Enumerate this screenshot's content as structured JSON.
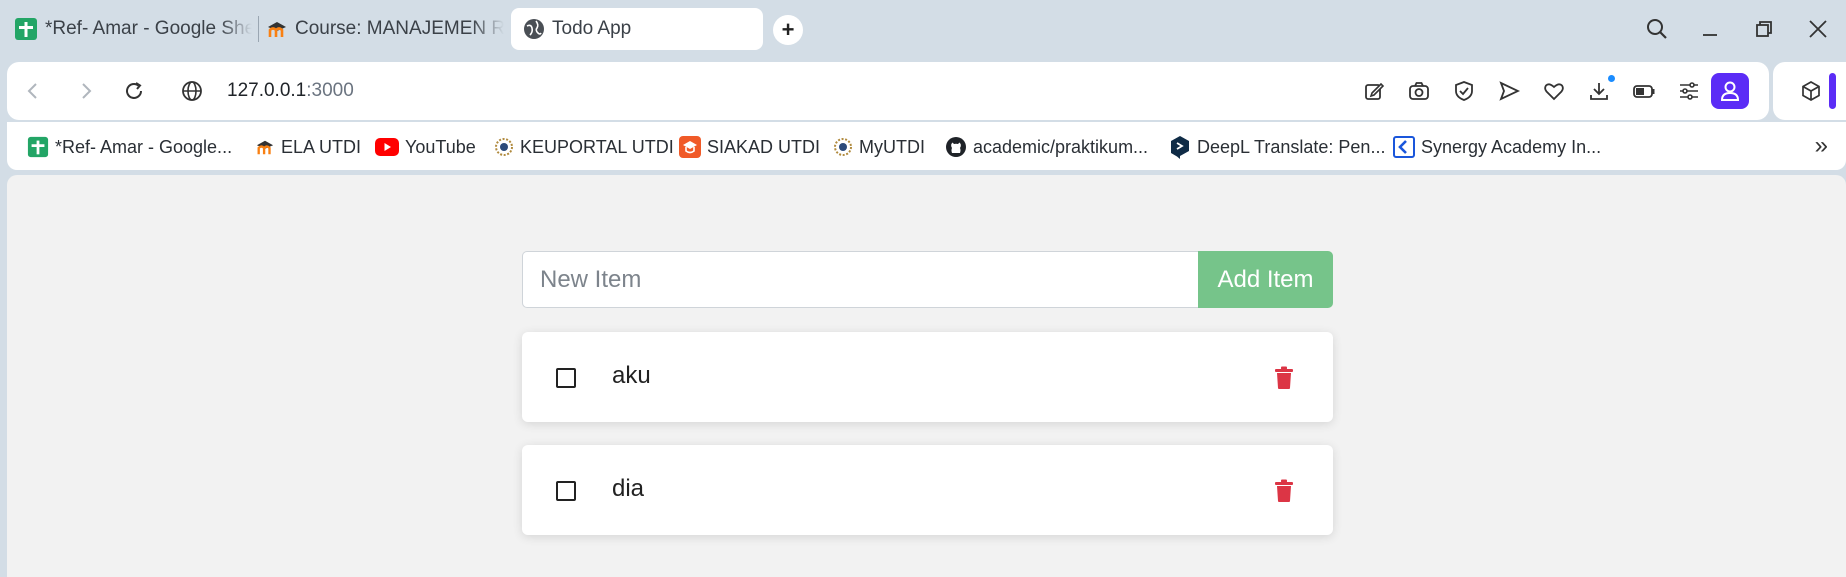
{
  "browser": {
    "tabs": [
      {
        "title": "*Ref- Amar - Google Sheets",
        "icon": "google-sheets-icon"
      },
      {
        "title": "Course: MANAJEMEN RESIKO",
        "icon": "moodle-icon"
      },
      {
        "title": "Todo App",
        "icon": "globe-icon",
        "active": true
      }
    ],
    "new_tab_label": "+",
    "address": {
      "host": "127.0.0.1",
      "port": ":3000"
    },
    "bookmarks": [
      {
        "label": "*Ref- Amar - Google...",
        "icon": "google-sheets-icon"
      },
      {
        "label": "ELA UTDI",
        "icon": "moodle-icon"
      },
      {
        "label": "YouTube",
        "icon": "youtube-icon"
      },
      {
        "label": "KEUPORTAL UTDI",
        "icon": "utdi-logo-icon"
      },
      {
        "label": "SIAKAD UTDI",
        "icon": "siakad-icon"
      },
      {
        "label": "MyUTDI",
        "icon": "utdi-logo-icon"
      },
      {
        "label": "academic/praktikum...",
        "icon": "github-icon"
      },
      {
        "label": "DeepL Translate: Pen...",
        "icon": "deepl-icon"
      },
      {
        "label": "Synergy Academy In...",
        "icon": "synergy-icon"
      }
    ],
    "bookmarks_more": "»",
    "colors": {
      "profile": "#5b2cf6",
      "download_dot": "#1a8cff"
    }
  },
  "app": {
    "input_placeholder": "New Item",
    "input_value": "",
    "add_button": "Add Item",
    "items": [
      {
        "text": "aku",
        "done": false
      },
      {
        "text": "dia",
        "done": false
      }
    ],
    "colors": {
      "add_button": "#76c48a",
      "delete_icon": "#dc3545",
      "page_bg": "#f2f2f2"
    }
  }
}
